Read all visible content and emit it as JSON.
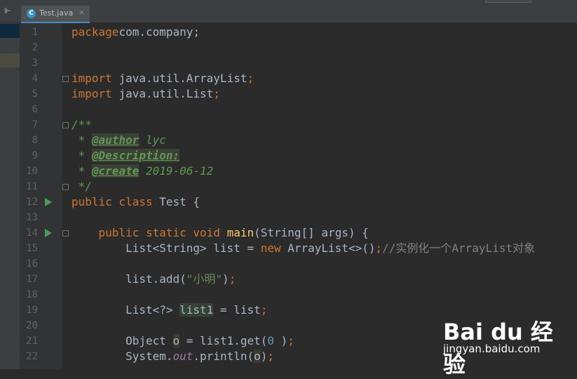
{
  "tab": {
    "title": "Test.java",
    "icon": "java-class-icon",
    "icon_letter": "C",
    "close": "×"
  },
  "sidebar": {
    "collapse_icon": "collapse-icon"
  },
  "editor": {
    "line_numbers": [
      "1",
      "2",
      "3",
      "4",
      "5",
      "6",
      "7",
      "8",
      "9",
      "10",
      "11",
      "12",
      "13",
      "14",
      "15",
      "16",
      "17",
      "18",
      "19",
      "20",
      "21",
      "22"
    ],
    "lines": [
      [
        [
          "kw",
          "package"
        ],
        [
          "",
          "com.company;"
        ]
      ],
      [],
      [],
      [
        [
          "kw",
          "import "
        ],
        [
          "",
          "java.util.ArrayList"
        ],
        [
          "kw",
          ";"
        ]
      ],
      [
        [
          "kw",
          "import "
        ],
        [
          "",
          "java.util.List"
        ],
        [
          "kw",
          ";"
        ]
      ],
      [],
      [
        [
          "doc",
          "/**"
        ]
      ],
      [
        [
          "doc",
          " * "
        ],
        [
          "tag",
          "@author"
        ],
        [
          "doc",
          " lyc"
        ]
      ],
      [
        [
          "doc",
          " * "
        ],
        [
          "tag",
          "@Description:"
        ]
      ],
      [
        [
          "doc",
          " * "
        ],
        [
          "tag",
          "@create"
        ],
        [
          "doc",
          " 2019-06-12"
        ]
      ],
      [
        [
          "doc",
          " */"
        ]
      ],
      [
        [
          "kw",
          "public class "
        ],
        [
          "",
          "Test {"
        ]
      ],
      [],
      [
        [
          "",
          "    "
        ],
        [
          "kw",
          "public static void "
        ],
        [
          "fn",
          "main"
        ],
        [
          "",
          "(String[] args) {"
        ]
      ],
      [
        [
          "",
          "        List<String> list = "
        ],
        [
          "kw",
          "new "
        ],
        [
          "",
          "ArrayList<>()"
        ],
        [
          "kw",
          ";"
        ],
        [
          "cm",
          "//实例化一个ArrayList对象"
        ]
      ],
      [],
      [
        [
          "",
          "        list.add("
        ],
        [
          "str",
          "\"小明\""
        ],
        [
          "",
          ")"
        ],
        [
          "kw",
          ";"
        ]
      ],
      [],
      [
        [
          "",
          "        List<?> "
        ],
        [
          "hl",
          "list1"
        ],
        [
          "",
          " = list"
        ],
        [
          "kw",
          ";"
        ]
      ],
      [],
      [
        [
          "",
          "        Object "
        ],
        [
          "hl2",
          "o"
        ],
        [
          "",
          " = list1.get("
        ],
        [
          "num",
          "0"
        ],
        [
          "",
          " )"
        ],
        [
          "kw",
          ";"
        ]
      ],
      [
        [
          "",
          "        System."
        ],
        [
          "sf",
          "out"
        ],
        [
          "",
          ".println("
        ],
        [
          "hl2",
          "o"
        ],
        [
          "",
          ")"
        ],
        [
          "kw",
          ";"
        ]
      ]
    ]
  },
  "watermark": {
    "brand": "Bai du 经验",
    "url": "jingyan.baidu.com"
  }
}
